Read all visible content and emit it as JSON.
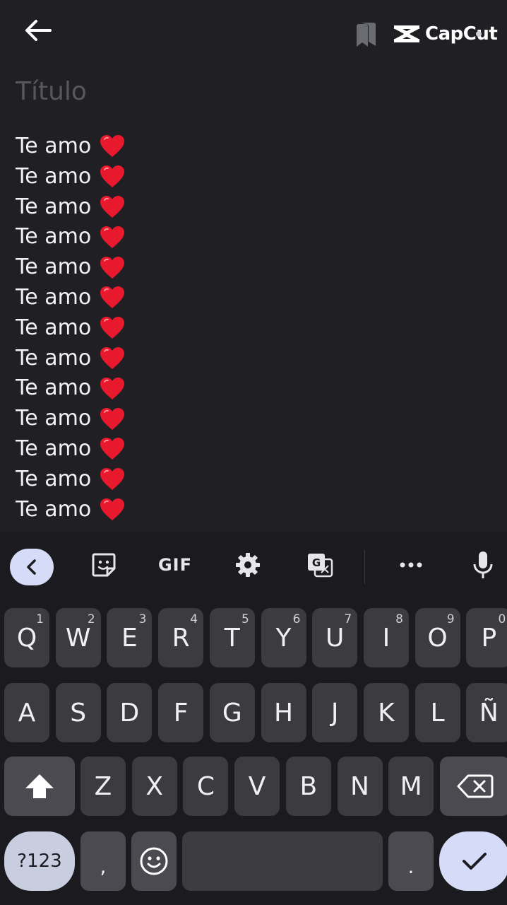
{
  "topbar": {
    "back_icon": "arrow-left-icon",
    "bookmark_icon": "bookmark-icon",
    "watermark": "CapCut"
  },
  "note": {
    "title_placeholder": "Título",
    "lines": [
      "Te amo",
      "Te amo",
      "Te amo",
      "Te amo",
      "Te amo",
      "Te amo",
      "Te amo",
      "Te amo",
      "Te amo",
      "Te amo",
      "Te amo",
      "Te amo",
      "Te amo"
    ],
    "emoji": "red-heart-emoji"
  },
  "keyboard": {
    "toolbar": {
      "collapse_icon": "chevron-left-icon",
      "sticker_icon": "sticker-icon",
      "gif_label": "GIF",
      "settings_icon": "gear-icon",
      "translate_icon": "translate-icon",
      "more_icon": "ellipsis-icon",
      "mic_icon": "microphone-icon"
    },
    "row1": [
      {
        "k": "Q",
        "h": "1"
      },
      {
        "k": "W",
        "h": "2"
      },
      {
        "k": "E",
        "h": "3"
      },
      {
        "k": "R",
        "h": "4"
      },
      {
        "k": "T",
        "h": "5"
      },
      {
        "k": "Y",
        "h": "6"
      },
      {
        "k": "U",
        "h": "7"
      },
      {
        "k": "I",
        "h": "8"
      },
      {
        "k": "O",
        "h": "9"
      },
      {
        "k": "P",
        "h": "0"
      }
    ],
    "row2": [
      "A",
      "S",
      "D",
      "F",
      "G",
      "H",
      "J",
      "K",
      "L",
      "Ñ"
    ],
    "row3": [
      "Z",
      "X",
      "C",
      "V",
      "B",
      "N",
      "M"
    ],
    "symbols_label": "?123",
    "comma_label": ",",
    "period_label": ".",
    "emoji_icon": "smiley-icon",
    "shift_icon": "shift-icon",
    "backspace_icon": "backspace-icon",
    "enter_icon": "checkmark-icon",
    "colors": {
      "accent": "#d6dcf7",
      "key": "#3b3b40",
      "background": "#1b1b1f"
    }
  }
}
